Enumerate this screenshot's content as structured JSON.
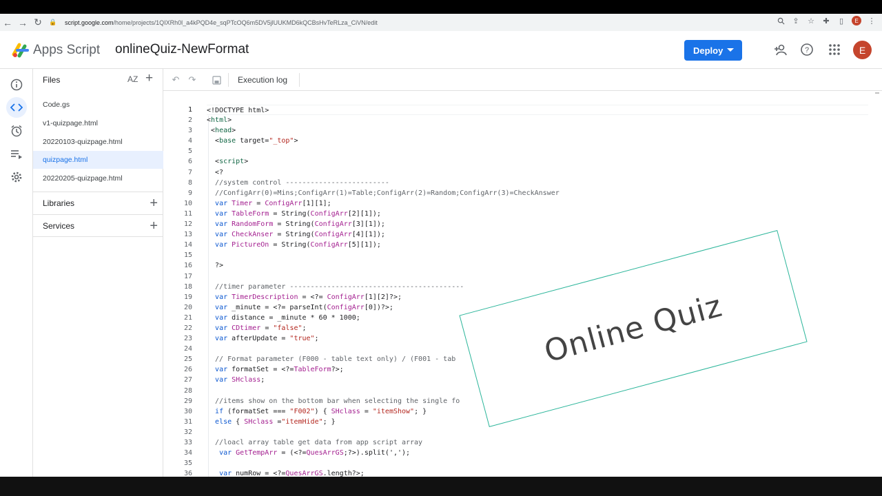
{
  "browser": {
    "url_host": "script.google.com",
    "url_path": "/home/projects/1QIXRh0l_a4kPQD4e_sqPTcOQ6m5DV5jlUUKMD6kQCBsHvTeRLza_CiVN/edit",
    "avatar_letter": "E"
  },
  "header": {
    "app_name": "Apps Script",
    "project_name": "onlineQuiz-NewFormat",
    "deploy_label": "Deploy",
    "avatar_letter": "E"
  },
  "files_panel": {
    "title": "Files",
    "sort_label": "AZ",
    "files": [
      "Code.gs",
      "v1-quizpage.html",
      "20220103-quizpage.html",
      "quizpage.html",
      "20220205-quizpage.html"
    ],
    "active_file": "quizpage.html",
    "sections": [
      "Libraries",
      "Services"
    ]
  },
  "toolbar": {
    "execution_log_label": "Execution log"
  },
  "editor": {
    "line_numbers": [
      "1",
      "2",
      "3",
      "4",
      "5",
      "6",
      "7",
      "8",
      "9",
      "10",
      "11",
      "12",
      "13",
      "14",
      "15",
      "16",
      "17",
      "18",
      "19",
      "20",
      "21",
      "22",
      "23",
      "24",
      "25",
      "26",
      "27",
      "28",
      "29",
      "30",
      "31",
      "32",
      "33",
      "34",
      "35",
      "36"
    ],
    "lines": [
      "<!DOCTYPE html>",
      "<html>",
      " <head>",
      "  <base target=\"_top\">",
      "",
      "  <script>",
      "  <?",
      "  //system control -------------------------",
      "  //ConfigArr(0)=Mins;ConfigArr(1)=Table;ConfigArr(2)=Random;ConfigArr(3)=CheckAnswer",
      "  var Timer = ConfigArr[1][1];",
      "  var TableForm = String(ConfigArr[2][1]);",
      "  var RandomForm = String(ConfigArr[3][1]);",
      "  var CheckAnser = String(ConfigArr[4][1]);",
      "  var PictureOn = String(ConfigArr[5][1]);",
      "",
      "  ?>",
      "",
      "  //timer parameter ------------------------------------------",
      "  var TimerDescription = <?= ConfigArr[1][2]?>;",
      "  var _minute = <?= parseInt(ConfigArr[0])?>;",
      "  var distance = _minute * 60 * 1000;",
      "  var CDtimer = \"false\";",
      "  var afterUpdate = \"true\";",
      "",
      "  // Format parameter (F000 - table text only) / (F001 - tab",
      "  var formatSet = <?=TableForm?>;",
      "  var SHclass;",
      "",
      "  //items show on the bottom bar when selecting the single fo",
      "  if (formatSet === \"F002\") { SHclass = \"itemShow\"; }",
      "  else { SHclass =\"itemHide\"; }",
      "",
      "  //loacl array table get data from app script array",
      "   var GetTempArr = (<?=QuesArrGS;?>).split(',');",
      "",
      "   var numRow = <?=QuesArrGS.length?>;"
    ]
  },
  "overlay": {
    "text": "Online Quiz",
    "border_color": "#2bb59a"
  },
  "colors": {
    "accent": "#1a73e8",
    "active_bg": "#e8f0fe",
    "avatar": "#c5452d"
  }
}
